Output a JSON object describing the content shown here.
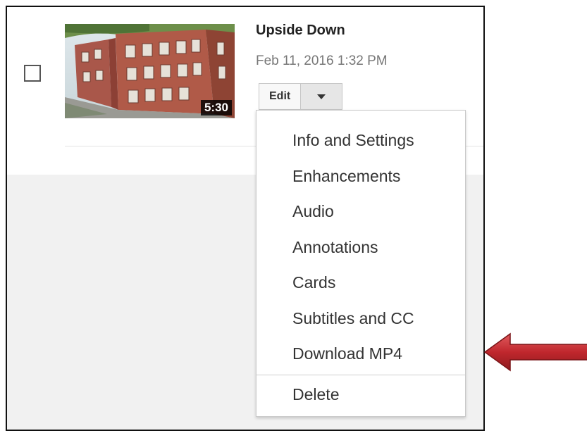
{
  "video": {
    "title": "Upside Down",
    "date": "Feb 11, 2016 1:32 PM",
    "duration": "5:30"
  },
  "buttons": {
    "edit_label": "Edit",
    "dropdown_icon": "caret-down-icon"
  },
  "menu": {
    "items": [
      {
        "label": "Info and Settings"
      },
      {
        "label": "Enhancements"
      },
      {
        "label": "Audio"
      },
      {
        "label": "Annotations"
      },
      {
        "label": "Cards"
      },
      {
        "label": "Subtitles and CC"
      },
      {
        "label": "Download MP4"
      }
    ],
    "delete_label": "Delete"
  },
  "colors": {
    "arrow": "#c0272d",
    "menu_text": "#333333",
    "gray_area": "#f1f1f1"
  }
}
